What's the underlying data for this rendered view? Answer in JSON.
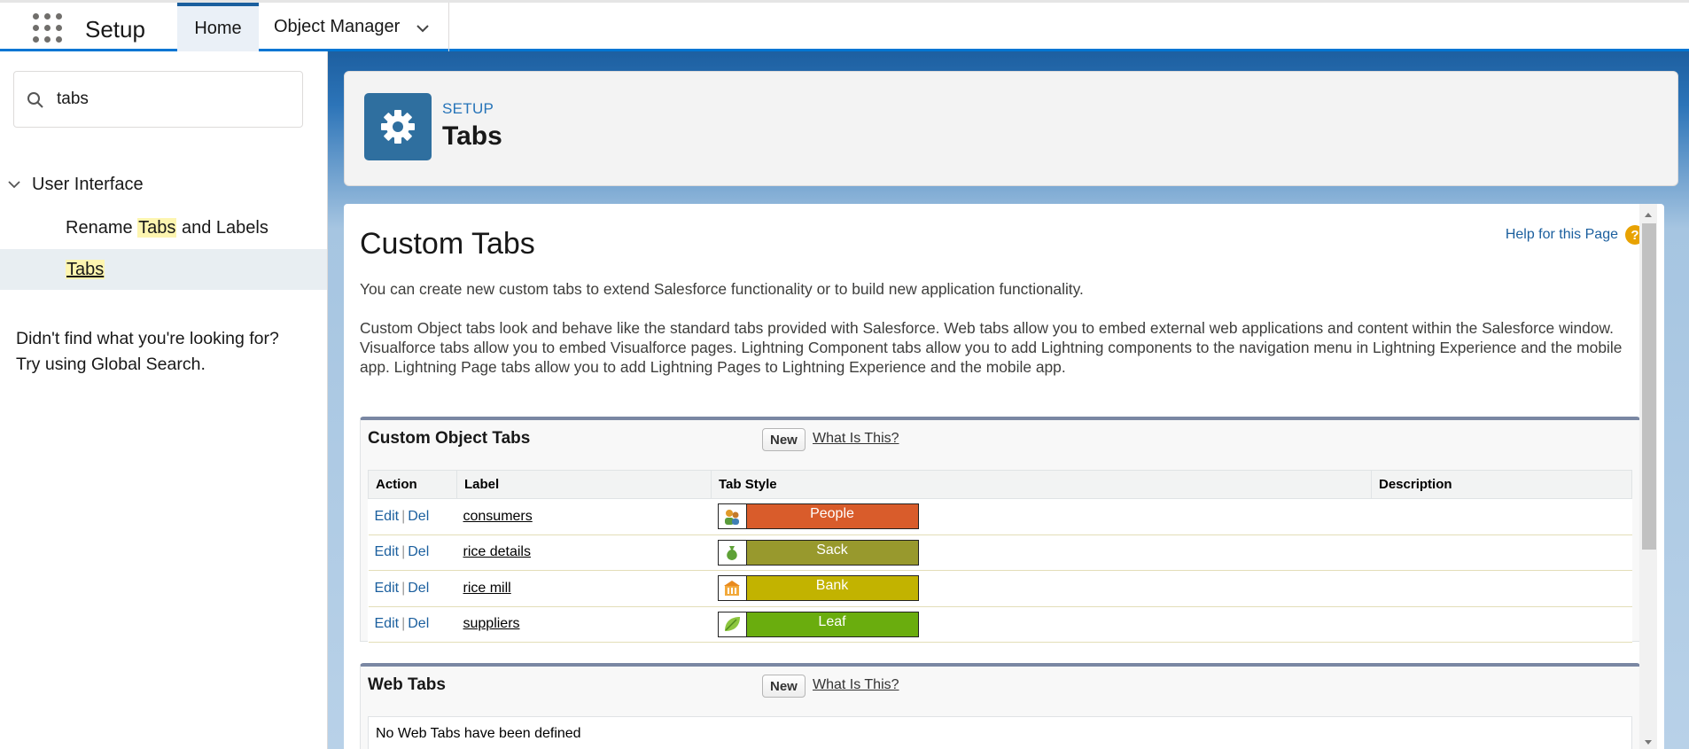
{
  "header": {
    "app_name": "Setup",
    "nav": {
      "home": "Home",
      "object_manager": "Object Manager"
    }
  },
  "sidebar": {
    "search_value": "tabs",
    "section": "User Interface",
    "items": [
      {
        "pre": "Rename ",
        "match": "Tabs",
        "post": " and Labels"
      },
      {
        "pre": "",
        "match": "Tabs",
        "post": ""
      }
    ],
    "not_found_line1": "Didn't find what you're looking for?",
    "not_found_line2": "Try using Global Search."
  },
  "page_header": {
    "breadcrumb": "SETUP",
    "title": "Tabs"
  },
  "content": {
    "title": "Custom Tabs",
    "help": "Help for this Page",
    "intro1": "You can create new custom tabs to extend Salesforce functionality or to build new application functionality.",
    "intro2": "Custom Object tabs look and behave like the standard tabs provided with Salesforce. Web tabs allow you to embed external web applications and content within the Salesforce window. Visualforce tabs allow you to embed Visualforce pages. Lightning Component tabs allow you to add Lightning components to the navigation menu in Lightning Experience and the mobile app. Lightning Page tabs allow you to add Lightning Pages to Lightning Experience and the mobile app."
  },
  "custom_object_tabs": {
    "title": "Custom Object Tabs",
    "new_label": "New",
    "what_label": "What Is This?",
    "columns": [
      "Action",
      "Label",
      "Tab Style",
      "Description"
    ],
    "edit_label": "Edit",
    "sep": "|",
    "del_label": "Del",
    "rows": [
      {
        "label": "consumers",
        "style": "People",
        "color": "#d95c2b",
        "icon": "people-icon"
      },
      {
        "label": "rice details",
        "style": "Sack",
        "color": "#98992d",
        "icon": "sack-icon"
      },
      {
        "label": "rice mill",
        "style": "Bank",
        "color": "#c2b300",
        "icon": "bank-icon"
      },
      {
        "label": "suppliers",
        "style": "Leaf",
        "color": "#6aad0e",
        "icon": "leaf-icon"
      }
    ]
  },
  "web_tabs": {
    "title": "Web Tabs",
    "new_label": "New",
    "what_label": "What Is This?",
    "empty": "No Web Tabs have been defined"
  }
}
